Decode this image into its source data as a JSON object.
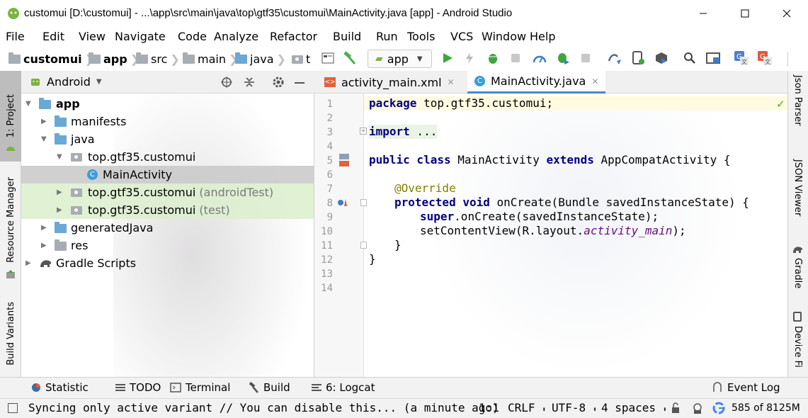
{
  "window": {
    "title": "customui [D:\\customui] - ...\\app\\src\\main\\java\\top\\gtf35\\customui\\MainActivity.java [app] - Android Studio",
    "minimize_icon": "minimize-icon",
    "maximize_icon": "maximize-icon",
    "close_icon": "close-icon"
  },
  "menu": [
    "File",
    "Edit",
    "View",
    "Navigate",
    "Code",
    "Analyze",
    "Refactor",
    "Build",
    "Run",
    "Tools",
    "VCS",
    "Window",
    "Help"
  ],
  "breadcrumb": [
    "customui",
    "app",
    "src",
    "main",
    "java",
    "t"
  ],
  "run_config": "app",
  "toolbar_icons": [
    "structure-icon",
    "hammer-icon",
    "run-icon",
    "apply-changes-icon",
    "debug-icon",
    "attach-debugger-icon",
    "profile-icon",
    "coverage-icon",
    "stop-icon",
    "sync-icon",
    "avd-manager-icon",
    "sdk-manager-icon",
    "search-icon",
    "project-structure-icon",
    "translate-icon",
    "translate-red-icon"
  ],
  "left_strip": {
    "project_tab": "1: Project",
    "resource_manager_tab": "Resource Manager",
    "build_variants_tab": "Build Variants"
  },
  "project_panel": {
    "view_selector": "Android",
    "tree": [
      {
        "label": "app",
        "bold": true
      },
      {
        "label": "manifests"
      },
      {
        "label": "java"
      },
      {
        "label": "top.gtf35.customui"
      },
      {
        "label": "MainActivity"
      },
      {
        "label": "top.gtf35.customui",
        "suffix": "(androidTest)"
      },
      {
        "label": "top.gtf35.customui",
        "suffix": "(test)"
      },
      {
        "label": "generatedJava"
      },
      {
        "label": "res"
      },
      {
        "label": "Gradle Scripts"
      }
    ]
  },
  "editor": {
    "tabs": [
      {
        "label": "activity_main.xml",
        "icon": "xml-layout-icon",
        "active": false
      },
      {
        "label": "MainActivity.java",
        "icon": "java-class-icon",
        "active": true
      }
    ],
    "line_numbers": [
      "1",
      "2",
      "3",
      "4",
      "5",
      "6",
      "7",
      "8",
      "9",
      "10",
      "11",
      "12",
      "13",
      "14"
    ],
    "lines": {
      "l1_kw": "package",
      "l1_rest": " top.gtf35.customui;",
      "l3_kw": "import",
      "l3_rest": " ...",
      "l5_kw1": "public class",
      "l5_mid": " MainActivity ",
      "l5_kw2": "extends",
      "l5_rest": " AppCompatActivity {",
      "l7_ann": "@Override",
      "l8_kw": "protected void",
      "l8_rest": " onCreate(Bundle savedInstanceState) {",
      "l9_kw": "super",
      "l9_rest": ".onCreate(savedInstanceState);",
      "l10_pre": "setContentView(R.layout.",
      "l10_ital": "activity_main",
      "l10_post": ");",
      "l11": "}",
      "l12": "}"
    }
  },
  "right_strip": [
    "Json Parser",
    "JSON Viewer",
    "Gradle",
    "Device Fi"
  ],
  "bottom_tabs": [
    {
      "label": "Statistic",
      "icon": "statistic-icon"
    },
    {
      "label": "TODO",
      "icon": "todo-icon"
    },
    {
      "label": "Terminal",
      "icon": "terminal-icon"
    },
    {
      "label": "Build",
      "icon": "build-icon"
    },
    {
      "label": "6: Logcat",
      "icon": "logcat-icon"
    }
  ],
  "event_log": "Event Log",
  "status": {
    "message": "Syncing only active variant // You can disable this... (a minute ago)",
    "position": "1:1",
    "line_sep": "CRLF",
    "encoding": "UTF-8",
    "indent": "4 spaces",
    "memory": "585 of 8125M"
  }
}
